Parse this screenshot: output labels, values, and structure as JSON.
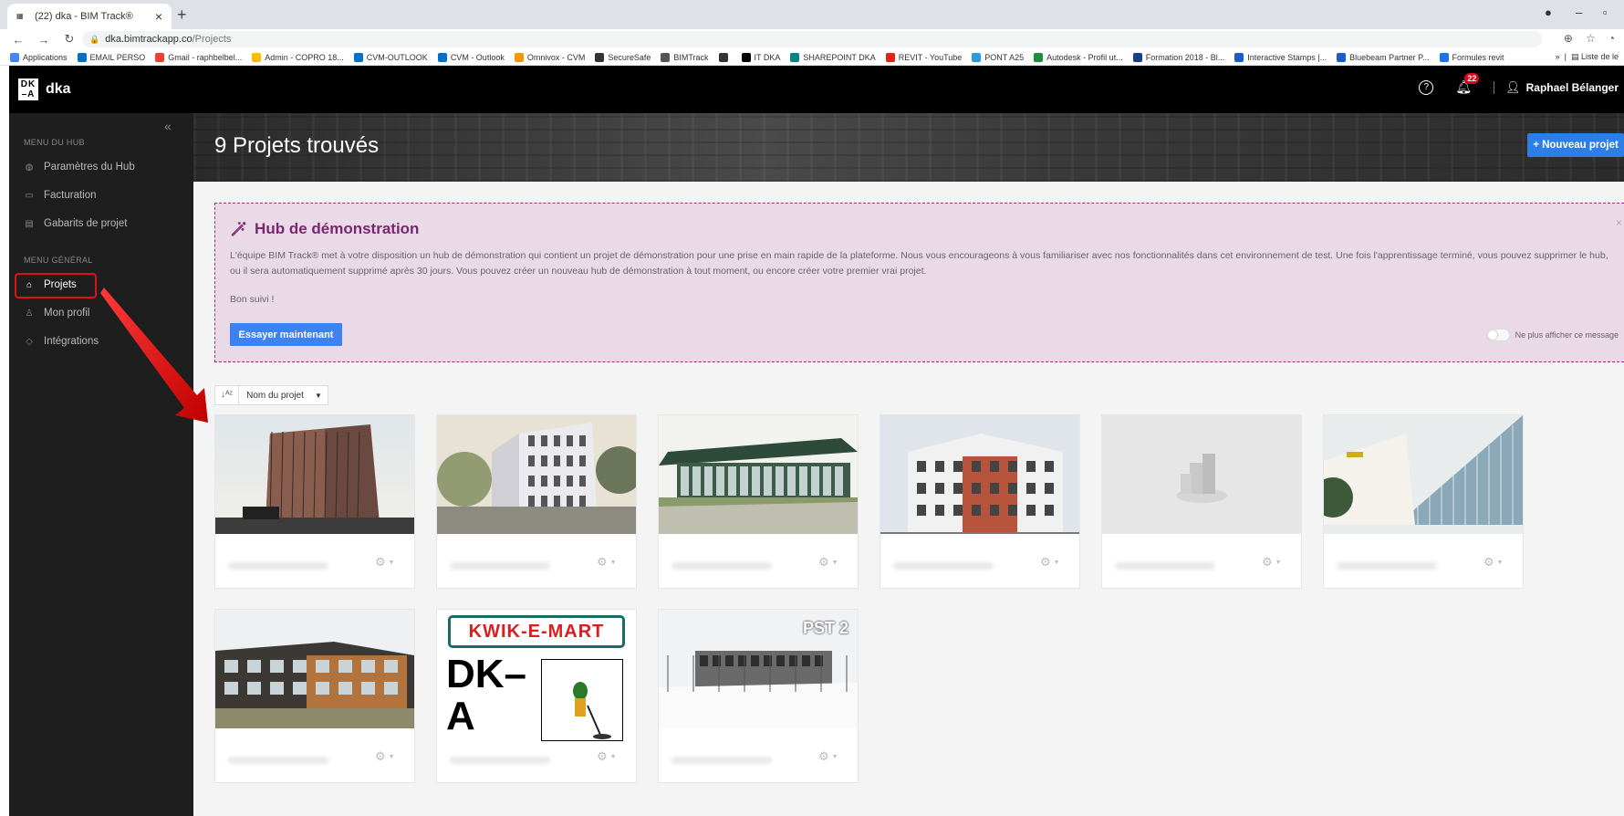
{
  "browser": {
    "tab_title": "(22) dka - BIM Track®",
    "tab_close": "×",
    "new_tab": "+",
    "url_host": "dka.bimtrackapp.co",
    "url_path": "/Projects",
    "bookmarks": [
      {
        "label": "Applications",
        "color": "#4285f4"
      },
      {
        "label": "EMAIL PERSO",
        "color": "#0072c6"
      },
      {
        "label": "Gmail - raphbelbel...",
        "color": "#ea4335"
      },
      {
        "label": "Admin - COPRO 18...",
        "color": "#fbbc05"
      },
      {
        "label": "CVM-OUTLOOK",
        "color": "#0072c6"
      },
      {
        "label": "CVM - Outlook",
        "color": "#0072c6"
      },
      {
        "label": "Omnivox - CVM",
        "color": "#f29900"
      },
      {
        "label": "SecureSafe",
        "color": "#333333"
      },
      {
        "label": "BIMTrack",
        "color": "#555555"
      },
      {
        "label": "",
        "color": "#333333"
      },
      {
        "label": "IT DKA",
        "color": "#000000"
      },
      {
        "label": "SHAREPOINT DKA",
        "color": "#038387"
      },
      {
        "label": "REVIT - YouTube",
        "color": "#e62117"
      },
      {
        "label": "PONT A25",
        "color": "#2b9be0"
      },
      {
        "label": "Autodesk - Profil ut...",
        "color": "#1e8e3e"
      },
      {
        "label": "Formation 2018 - Bl...",
        "color": "#1a3c8c"
      },
      {
        "label": "Interactive Stamps |...",
        "color": "#1a5cc8"
      },
      {
        "label": "Bluebeam Partner P...",
        "color": "#1a5cc8"
      },
      {
        "label": "Formules revit",
        "color": "#1a73e8"
      }
    ],
    "bookmarks_more": "»",
    "reading_list": "Liste de le"
  },
  "app": {
    "logo_text": "DK\n–A",
    "brand": "dka",
    "help": "?",
    "notifications_count": "22",
    "user_name": "Raphael Bélanger"
  },
  "sidebar": {
    "collapse": "«",
    "hub_menu_title": "MENU DU HUB",
    "hub_items": [
      {
        "label": "Paramètres du Hub",
        "icon": "globe-icon"
      },
      {
        "label": "Facturation",
        "icon": "credit-card-icon"
      },
      {
        "label": "Gabarits de projet",
        "icon": "document-icon"
      }
    ],
    "general_menu_title": "MENU GÉNÉRAL",
    "general_items": [
      {
        "label": "Projets",
        "icon": "home-icon",
        "active": true
      },
      {
        "label": "Mon profil",
        "icon": "user-icon"
      },
      {
        "label": "Intégrations",
        "icon": "tag-icon"
      }
    ]
  },
  "header": {
    "title": "9 Projets trouvés",
    "new_project_button": "+ Nouveau projet"
  },
  "demo_banner": {
    "title": "Hub de démonstration",
    "close": "×",
    "text": "L'équipe BIM Track® met à votre disposition un hub de démonstration qui contient un projet de démonstration pour une prise en main rapide de la plateforme. Nous vous encourageons à vous familiariser avec nos fonctionnalités dans cet environnement de test. Une fois l'apprentissage terminé, vous pouvez supprimer le hub, ou il sera automatiquement supprimé après 30 jours. Vous pouvez créer un nouveau hub de démonstration à tout moment, ou encore créer votre premier vrai projet.",
    "signoff": "Bon suivi !",
    "try_button": "Essayer maintenant",
    "dont_show_label": "Ne plus afficher ce message"
  },
  "sort": {
    "direction_icon": "↓A/Z",
    "selected": "Nom du projet"
  },
  "projects": [
    {
      "thumb": "building-glass-dark"
    },
    {
      "thumb": "building-white-street"
    },
    {
      "thumb": "building-green-pavilion"
    },
    {
      "thumb": "building-brick-apartments"
    },
    {
      "thumb": "placeholder"
    },
    {
      "thumb": "building-glass-curve"
    },
    {
      "thumb": "building-school-brick"
    },
    {
      "thumb": "kwik-e-mart-logo",
      "logo_text": "KWIK-E-MART",
      "letters": "DK–A"
    },
    {
      "thumb": "building-winter",
      "overlay": "PST 2"
    }
  ],
  "colors": {
    "accent": "#2d7ee6",
    "demo_bg": "#ead9e7",
    "demo_title": "#7a2670",
    "highlight": "#e0101a",
    "badge": "#e3001b"
  }
}
